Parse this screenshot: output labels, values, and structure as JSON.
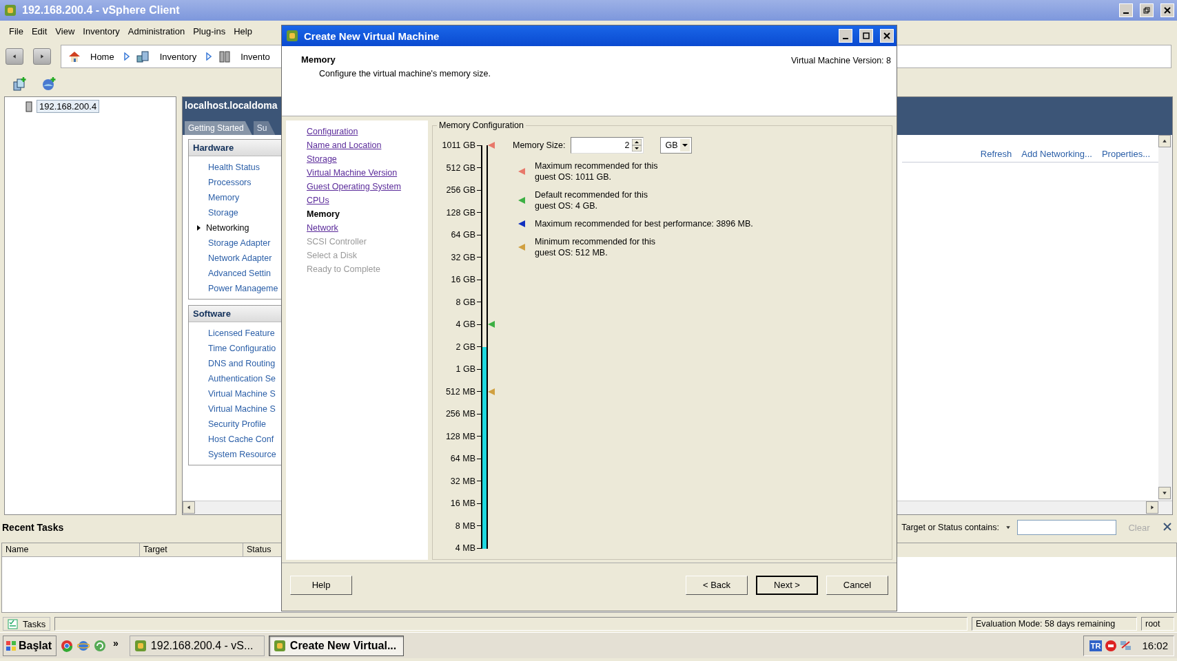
{
  "window": {
    "title": "192.168.200.4 - vSphere Client"
  },
  "menu": [
    "File",
    "Edit",
    "View",
    "Inventory",
    "Administration",
    "Plug-ins",
    "Help"
  ],
  "breadcrumb": [
    {
      "label": "Home",
      "kind": "home"
    },
    {
      "label": "Inventory",
      "kind": "inventory"
    },
    {
      "label": "Invento",
      "kind": "host"
    }
  ],
  "tree": [
    {
      "label": "192.168.200.4",
      "selected": true
    }
  ],
  "host_panel": {
    "title": "localhost.localdoma",
    "tabs": [
      {
        "label": "Getting Started",
        "selected": true
      },
      {
        "label": "Su",
        "selected": false
      }
    ],
    "sections": [
      {
        "title": "Hardware",
        "items": [
          {
            "label": "Health Status",
            "selected": false
          },
          {
            "label": "Processors",
            "selected": false
          },
          {
            "label": "Memory",
            "selected": false
          },
          {
            "label": "Storage",
            "selected": false
          },
          {
            "label": "Networking",
            "selected": true
          },
          {
            "label": "Storage Adapter",
            "selected": false
          },
          {
            "label": "Network Adapter",
            "selected": false
          },
          {
            "label": "Advanced Settin",
            "selected": false
          },
          {
            "label": "Power Manageme",
            "selected": false
          }
        ]
      },
      {
        "title": "Software",
        "items": [
          {
            "label": "Licensed Feature",
            "selected": false
          },
          {
            "label": "Time Configuratio",
            "selected": false
          },
          {
            "label": "DNS and Routing",
            "selected": false
          },
          {
            "label": "Authentication Se",
            "selected": false
          },
          {
            "label": "Virtual Machine S",
            "selected": false
          },
          {
            "label": "Virtual Machine S",
            "selected": false
          },
          {
            "label": "Security Profile",
            "selected": false
          },
          {
            "label": "Host Cache Conf",
            "selected": false
          },
          {
            "label": "System Resource",
            "selected": false
          }
        ]
      }
    ],
    "actions": [
      "Refresh",
      "Add Networking...",
      "Properties..."
    ]
  },
  "recent_tasks": {
    "title": "Recent Tasks",
    "filter_label": "Target or Status contains:",
    "clear": "Clear",
    "columns": [
      "Name",
      "Target",
      "Status"
    ]
  },
  "status_bar": {
    "tasks": "Tasks",
    "evaluation": "Evaluation Mode: 58 days remaining",
    "user": "root"
  },
  "taskbar": {
    "start": "Başlat",
    "more": "»",
    "tasks": [
      {
        "label": "192.168.200.4 - vS...",
        "selected": false
      },
      {
        "label": "Create New Virtual...",
        "selected": true
      }
    ],
    "language": "TR",
    "time": "16:02"
  },
  "dialog": {
    "title": "Create New Virtual Machine",
    "heading": "Memory",
    "subheading": "Configure the virtual machine's memory size.",
    "version": "Virtual Machine Version: 8",
    "steps": [
      {
        "label": "Configuration",
        "selected": false,
        "disabled": false
      },
      {
        "label": "Name and Location",
        "selected": false,
        "disabled": false
      },
      {
        "label": "Storage",
        "selected": false,
        "disabled": false
      },
      {
        "label": "Virtual Machine Version",
        "selected": false,
        "disabled": false
      },
      {
        "label": "Guest Operating System",
        "selected": false,
        "disabled": false
      },
      {
        "label": "CPUs",
        "selected": false,
        "disabled": false
      },
      {
        "label": "Memory",
        "selected": true,
        "disabled": false
      },
      {
        "label": "Network",
        "selected": false,
        "disabled": false
      },
      {
        "label": "SCSI Controller",
        "selected": false,
        "disabled": true
      },
      {
        "label": "Select a Disk",
        "selected": false,
        "disabled": true
      },
      {
        "label": "Ready to Complete",
        "selected": false,
        "disabled": true
      }
    ],
    "memory": {
      "title": "Memory Configuration",
      "size_label": "Memory Size:",
      "size_value": "2",
      "unit": "GB",
      "scale": {
        "level": 0.5,
        "ticks": [
          {
            "label": "1011 GB",
            "color": "#e8786a"
          },
          {
            "label": "512 GB"
          },
          {
            "label": "256 GB"
          },
          {
            "label": "128 GB"
          },
          {
            "label": "64 GB"
          },
          {
            "label": "32 GB"
          },
          {
            "label": "16 GB"
          },
          {
            "label": "8 GB"
          },
          {
            "label": "4 GB",
            "color": "#3cb043"
          },
          {
            "label": "2 GB"
          },
          {
            "label": "1 GB"
          },
          {
            "label": "512 MB",
            "color": "#d0a040"
          },
          {
            "label": "256 MB"
          },
          {
            "label": "128 MB"
          },
          {
            "label": "64 MB"
          },
          {
            "label": "32 MB"
          },
          {
            "label": "16 MB"
          },
          {
            "label": "8 MB"
          },
          {
            "label": "4 MB"
          }
        ]
      },
      "legend": [
        {
          "color": "#e8786a",
          "text": "Maximum recommended for this\nguest OS: 1011 GB."
        },
        {
          "color": "#3cb043",
          "text": "Default recommended for this\nguest OS: 4 GB."
        },
        {
          "color": "#1030c0",
          "text": "Maximum recommended for best performance: 3896 MB."
        },
        {
          "color": "#d0a040",
          "text": "Minimum recommended for this\nguest OS: 512 MB."
        }
      ]
    },
    "buttons": [
      {
        "label": "Help",
        "kind": "help"
      },
      {
        "label": "< Back",
        "kind": "normal"
      },
      {
        "label": "Next >",
        "kind": "default"
      },
      {
        "label": "Cancel",
        "kind": "normal"
      }
    ]
  }
}
